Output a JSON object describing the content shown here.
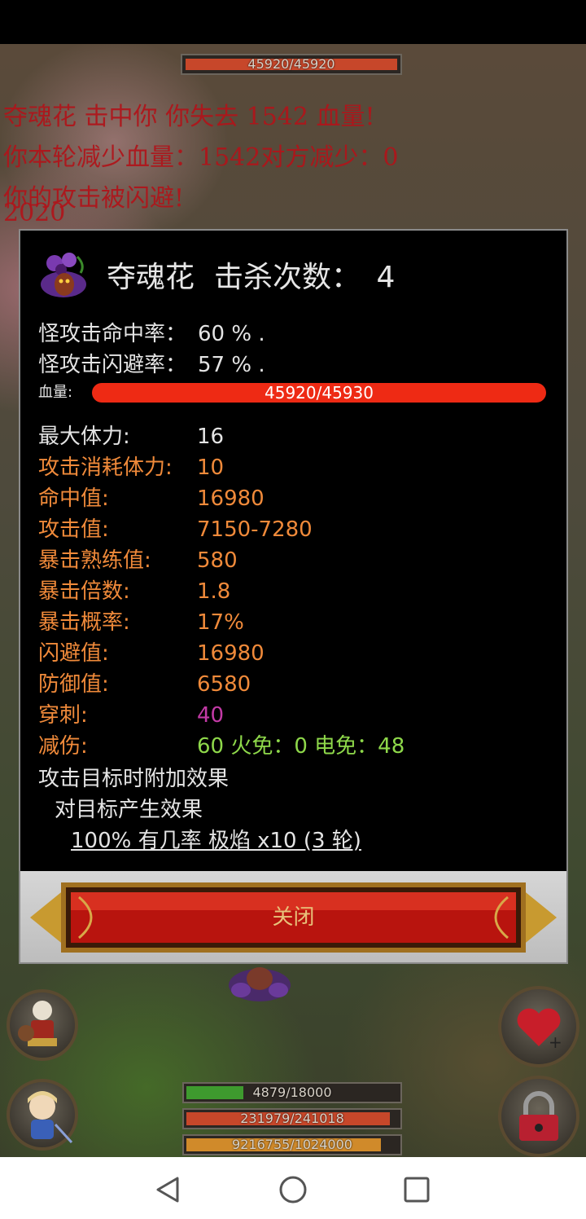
{
  "game": {
    "top_bar": {
      "value": "45920/45920",
      "fill_fraction": 1.0
    },
    "log_lines": [
      "夺魂花 击中你 你失去 1542 血量!",
      "你本轮减少血量：1542对方减少：0",
      "你的攻击被闪避!",
      "2020"
    ],
    "status_bars": [
      {
        "name": "stamina",
        "value": "4879/18000",
        "fill_fraction": 0.27,
        "color": "#3e9a2e"
      },
      {
        "name": "health",
        "value": "231979/241018",
        "fill_fraction": 0.96,
        "color": "#c7472a"
      },
      {
        "name": "experience",
        "value": "9216755/1024000",
        "fill_fraction": 0.92,
        "color": "#d08a2a"
      }
    ]
  },
  "modal": {
    "monster_name": "夺魂花",
    "kill_count_label": "击杀次数：",
    "kill_count": "4",
    "hit_rate_label": "怪攻击命中率：",
    "hit_rate_value": "60 % .",
    "dodge_rate_label": "怪攻击闪避率：",
    "dodge_rate_value": "57 % .",
    "hp_label": "血量:",
    "hp_value": "45920/45930",
    "hp_fill_fraction": 0.9998,
    "stats": [
      {
        "label": "最大体力:",
        "value": "16",
        "label_color": "w",
        "value_color": "w"
      },
      {
        "label": "攻击消耗体力:",
        "value": "10",
        "label_color": "o",
        "value_color": "o"
      },
      {
        "label": "命中值:",
        "value": "16980",
        "label_color": "o",
        "value_color": "o"
      },
      {
        "label": "攻击值:",
        "value": "7150-7280",
        "label_color": "o",
        "value_color": "o"
      },
      {
        "label": "暴击熟练值:",
        "value": "580",
        "label_color": "o",
        "value_color": "o"
      },
      {
        "label": "暴击倍数:",
        "value": "1.8",
        "label_color": "o",
        "value_color": "o"
      },
      {
        "label": "暴击概率:",
        "value": "17%",
        "label_color": "o",
        "value_color": "o"
      },
      {
        "label": "闪避值:",
        "value": "16980",
        "label_color": "o",
        "value_color": "o"
      },
      {
        "label": "防御值:",
        "value": "6580",
        "label_color": "o",
        "value_color": "o"
      },
      {
        "label": "穿刺:",
        "value": "40",
        "label_color": "o",
        "value_color": "p"
      },
      {
        "label": "减伤:",
        "value": "60 火免：0 电免：48",
        "label_color": "o",
        "value_color": "g"
      }
    ],
    "effects_header": "攻击目标时附加效果",
    "effects_subheader": "对目标产生效果",
    "effect_line": "100% 有几率 极焰 x10 (3 轮)",
    "close_label": "关闭"
  },
  "icons": {
    "monster": "flower-monster-icon",
    "heal": "heart-plus-icon",
    "lock": "lock-icon",
    "nav_back": "back-triangle-icon",
    "nav_home": "home-circle-icon",
    "nav_recent": "recent-square-icon"
  }
}
